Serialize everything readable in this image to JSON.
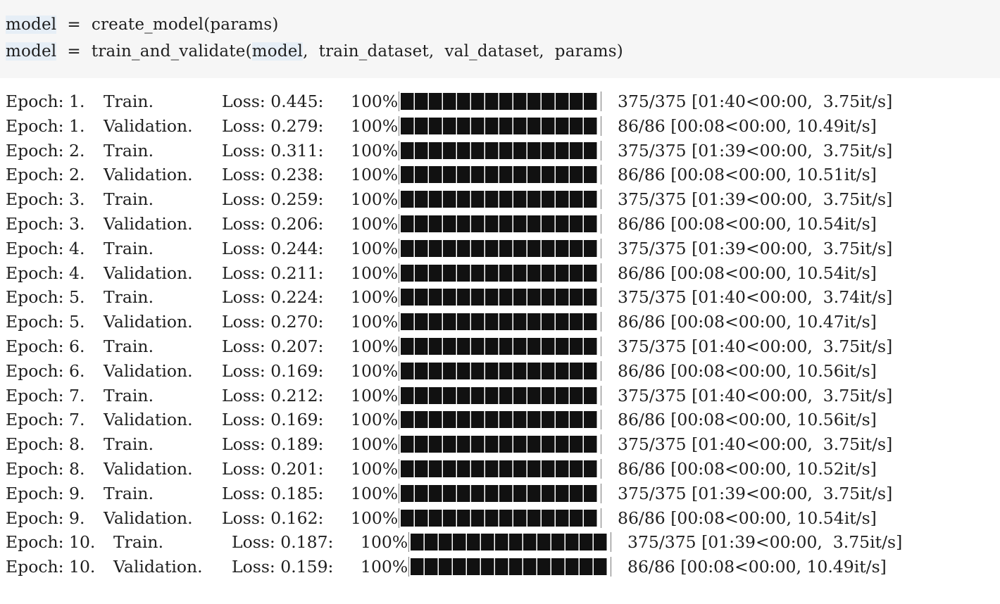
{
  "code_cell": {
    "lines": [
      {
        "var": "model",
        "op": "=",
        "expr_parts": [
          "create_model(params)"
        ]
      },
      {
        "var": "model",
        "op": "=",
        "expr_pre": "train_and_validate(",
        "expr_hl": "model",
        "expr_post": ",  train_dataset,  val_dataset,  params)"
      }
    ]
  },
  "output": {
    "rows": [
      {
        "epoch": "Epoch: 1.",
        "phase": "Train.",
        "loss": "Loss: 0.445:",
        "pct": "100%",
        "progress": 1.0,
        "stats": "375/375 [01:40<00:00,  3.75it/s]"
      },
      {
        "epoch": "Epoch: 1.",
        "phase": "Validation.",
        "loss": "Loss: 0.279:",
        "pct": "100%",
        "progress": 1.0,
        "stats": "86/86 [00:08<00:00, 10.49it/s]"
      },
      {
        "epoch": "Epoch: 2.",
        "phase": "Train.",
        "loss": "Loss: 0.311:",
        "pct": "100%",
        "progress": 1.0,
        "stats": "375/375 [01:39<00:00,  3.75it/s]"
      },
      {
        "epoch": "Epoch: 2.",
        "phase": "Validation.",
        "loss": "Loss: 0.238:",
        "pct": "100%",
        "progress": 1.0,
        "stats": "86/86 [00:08<00:00, 10.51it/s]"
      },
      {
        "epoch": "Epoch: 3.",
        "phase": "Train.",
        "loss": "Loss: 0.259:",
        "pct": "100%",
        "progress": 1.0,
        "stats": "375/375 [01:39<00:00,  3.75it/s]"
      },
      {
        "epoch": "Epoch: 3.",
        "phase": "Validation.",
        "loss": "Loss: 0.206:",
        "pct": "100%",
        "progress": 1.0,
        "stats": "86/86 [00:08<00:00, 10.54it/s]"
      },
      {
        "epoch": "Epoch: 4.",
        "phase": "Train.",
        "loss": "Loss: 0.244:",
        "pct": "100%",
        "progress": 1.0,
        "stats": "375/375 [01:39<00:00,  3.75it/s]"
      },
      {
        "epoch": "Epoch: 4.",
        "phase": "Validation.",
        "loss": "Loss: 0.211:",
        "pct": "100%",
        "progress": 1.0,
        "stats": "86/86 [00:08<00:00, 10.54it/s]"
      },
      {
        "epoch": "Epoch: 5.",
        "phase": "Train.",
        "loss": "Loss: 0.224:",
        "pct": "100%",
        "progress": 1.0,
        "stats": "375/375 [01:40<00:00,  3.74it/s]"
      },
      {
        "epoch": "Epoch: 5.",
        "phase": "Validation.",
        "loss": "Loss: 0.270:",
        "pct": "100%",
        "progress": 1.0,
        "stats": "86/86 [00:08<00:00, 10.47it/s]"
      },
      {
        "epoch": "Epoch: 6.",
        "phase": "Train.",
        "loss": "Loss: 0.207:",
        "pct": "100%",
        "progress": 1.0,
        "stats": "375/375 [01:40<00:00,  3.75it/s]"
      },
      {
        "epoch": "Epoch: 6.",
        "phase": "Validation.",
        "loss": "Loss: 0.169:",
        "pct": "100%",
        "progress": 1.0,
        "stats": "86/86 [00:08<00:00, 10.56it/s]"
      },
      {
        "epoch": "Epoch: 7.",
        "phase": "Train.",
        "loss": "Loss: 0.212:",
        "pct": "100%",
        "progress": 1.0,
        "stats": "375/375 [01:40<00:00,  3.75it/s]"
      },
      {
        "epoch": "Epoch: 7.",
        "phase": "Validation.",
        "loss": "Loss: 0.169:",
        "pct": "100%",
        "progress": 1.0,
        "stats": "86/86 [00:08<00:00, 10.56it/s]"
      },
      {
        "epoch": "Epoch: 8.",
        "phase": "Train.",
        "loss": "Loss: 0.189:",
        "pct": "100%",
        "progress": 1.0,
        "stats": "375/375 [01:40<00:00,  3.75it/s]"
      },
      {
        "epoch": "Epoch: 8.",
        "phase": "Validation.",
        "loss": "Loss: 0.201:",
        "pct": "100%",
        "progress": 1.0,
        "stats": "86/86 [00:08<00:00, 10.52it/s]"
      },
      {
        "epoch": "Epoch: 9.",
        "phase": "Train.",
        "loss": "Loss: 0.185:",
        "pct": "100%",
        "progress": 1.0,
        "stats": "375/375 [01:39<00:00,  3.75it/s]"
      },
      {
        "epoch": "Epoch: 9.",
        "phase": "Validation.",
        "loss": "Loss: 0.162:",
        "pct": "100%",
        "progress": 1.0,
        "stats": "86/86 [00:08<00:00, 10.54it/s]"
      },
      {
        "epoch": "Epoch: 10.",
        "phase": "Train.",
        "loss": "Loss: 0.187:",
        "pct": "100%",
        "progress": 1.0,
        "stats": "375/375 [01:39<00:00,  3.75it/s]"
      },
      {
        "epoch": "Epoch: 10.",
        "phase": "Validation.",
        "loss": "Loss: 0.159:",
        "pct": "100%",
        "progress": 1.0,
        "stats": "86/86 [00:08<00:00, 10.49it/s]"
      }
    ]
  }
}
